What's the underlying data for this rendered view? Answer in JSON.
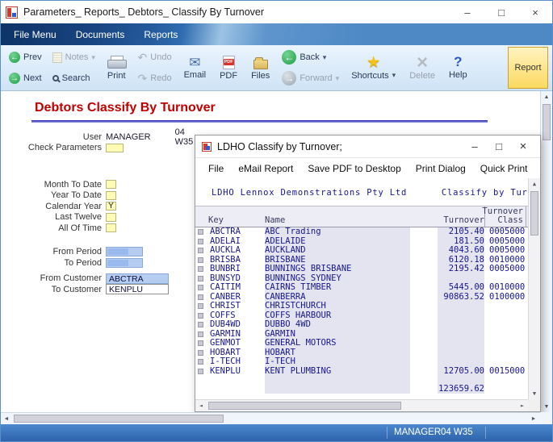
{
  "title_bar": {
    "title": "Parameters_ Reports_ Debtors_ Classify By Turnover",
    "minimize": "–",
    "maximize": "□",
    "close": "×"
  },
  "menu_bar": {
    "items": [
      "File Menu",
      "Documents",
      "Reports"
    ]
  },
  "toolbar": {
    "prev": "Prev",
    "next": "Next",
    "notes": "Notes",
    "search": "Search",
    "print": "Print",
    "undo": "Undo",
    "redo": "Redo",
    "email": "Email",
    "pdf": "PDF",
    "files": "Files",
    "back": "Back",
    "forward": "Forward",
    "shortcuts": "Shortcuts",
    "delete": "Delete",
    "help": "Help",
    "report": "Report"
  },
  "content": {
    "heading": "Debtors Classify By Turnover",
    "form": {
      "user_label": "User",
      "user_value": "MANAGER",
      "user_station": "04 W35",
      "check_parameters_label": "Check Parameters",
      "month_to_date_label": "Month To Date",
      "year_to_date_label": "Year To Date",
      "calendar_year_label": "Calendar Year",
      "calendar_year_value": "Y",
      "last_twelve_label": "Last Twelve",
      "all_of_time_label": "All Of Time",
      "from_period_label": "From Period",
      "to_period_label": "To Period",
      "from_customer_label": "From Customer",
      "from_customer_value": "ABCTRA",
      "to_customer_label": "To Customer",
      "to_customer_value": "KENPLU"
    }
  },
  "popup": {
    "title": "LDHO Classify by Turnover;",
    "minimize": "–",
    "maximize": "□",
    "close": "×",
    "menu_items": [
      "File",
      "eMail Report",
      "Save PDF to Desktop",
      "Print Dialog",
      "Quick Print"
    ],
    "report_header": "LDHO Lennox Demonstrations Pty Ltd      Classify by Turnover",
    "columns": {
      "key": "Key",
      "name": "Name",
      "turnover": "Turnover",
      "class_line1": "Turnover",
      "class_line2": "Class"
    },
    "rows": [
      {
        "key": "ABCTRA",
        "name": "ABC Trading",
        "turnover": "2105.40",
        "turnover_class": "0005000"
      },
      {
        "key": "ADELAI",
        "name": "ADELAIDE",
        "turnover": "181.50",
        "turnover_class": "0005000"
      },
      {
        "key": "AUCKLA",
        "name": "AUCKLAND",
        "turnover": "4043.60",
        "turnover_class": "0005000"
      },
      {
        "key": "BRISBA",
        "name": "BRISBANE",
        "turnover": "6120.18",
        "turnover_class": "0010000"
      },
      {
        "key": "BUNBRI",
        "name": "BUNNINGS BRISBANE",
        "turnover": "2195.42",
        "turnover_class": "0005000"
      },
      {
        "key": "BUNSYD",
        "name": "BUNNINGS SYDNEY",
        "turnover": "",
        "turnover_class": ""
      },
      {
        "key": "CAITIM",
        "name": "CAIRNS TIMBER",
        "turnover": "5445.00",
        "turnover_class": "0010000"
      },
      {
        "key": "CANBER",
        "name": "CANBERRA",
        "turnover": "90863.52",
        "turnover_class": "0100000"
      },
      {
        "key": "CHRIST",
        "name": "CHRISTCHURCH",
        "turnover": "",
        "turnover_class": ""
      },
      {
        "key": "COFFS",
        "name": "COFFS HARBOUR",
        "turnover": "",
        "turnover_class": ""
      },
      {
        "key": "DUB4WD",
        "name": "DUBBO 4WD",
        "turnover": "",
        "turnover_class": ""
      },
      {
        "key": "GARMIN",
        "name": "GARMIN",
        "turnover": "",
        "turnover_class": ""
      },
      {
        "key": "GENMOT",
        "name": "GENERAL MOTORS",
        "turnover": "",
        "turnover_class": ""
      },
      {
        "key": "HOBART",
        "name": "HOBART",
        "turnover": "",
        "turnover_class": ""
      },
      {
        "key": "I-TECH",
        "name": "I-TECH",
        "turnover": "",
        "turnover_class": ""
      },
      {
        "key": "KENPLU",
        "name": "KENT PLUMBING",
        "turnover": "12705.00",
        "turnover_class": "0015000"
      }
    ],
    "total": "123659.62"
  },
  "status_bar": {
    "user": "MANAGER",
    "station": "04 W35"
  },
  "colors": {
    "heading_red": "#c00000",
    "field_yellow": "#fffbb4",
    "selection_blue": "#b6cdf2",
    "report_text_navy": "#16168e",
    "status_blue": "#3a76c4",
    "report_button_yellow": "#fcd95f"
  }
}
